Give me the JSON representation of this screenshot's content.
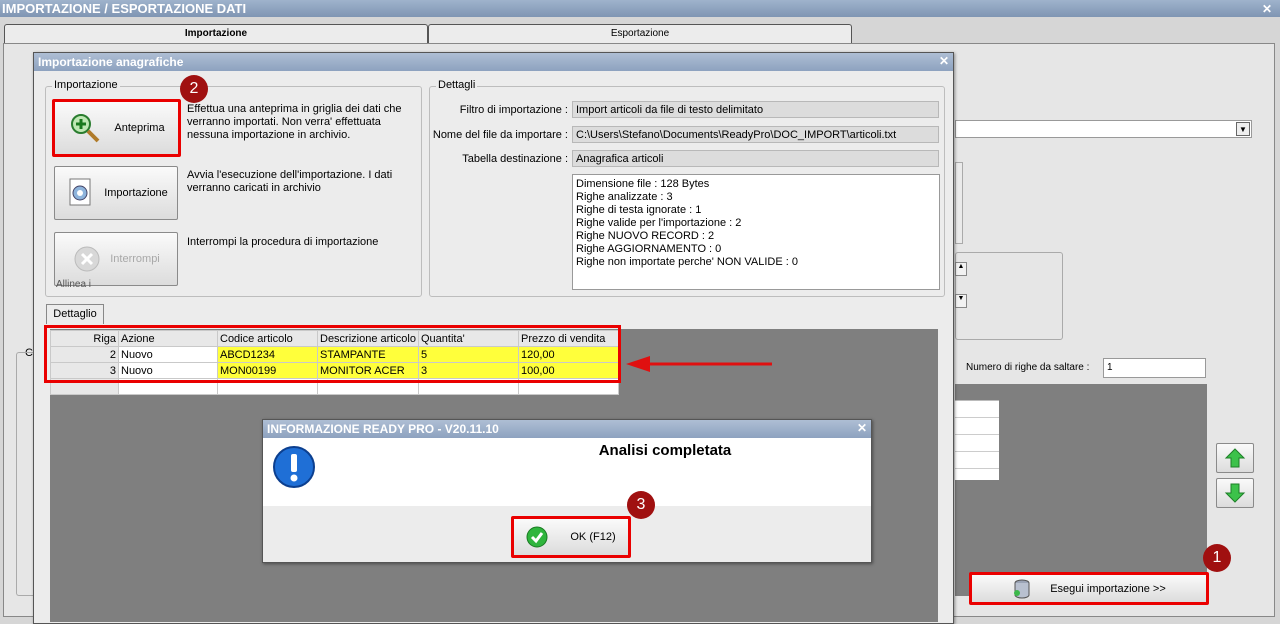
{
  "window": {
    "title": "IMPORTAZIONE / ESPORTAZIONE DATI"
  },
  "tabs": [
    {
      "label": "Importazione"
    },
    {
      "label": "Esportazione"
    }
  ],
  "background": {
    "righe_label": "Numero di righe da saltare :",
    "righe_value": "1",
    "esegui_label": "Esegui importazione >>",
    "left_label_c": "C",
    "hidden_label": "Allinea i"
  },
  "dialog": {
    "title": "Importazione anagrafiche",
    "import_group": "Importazione",
    "anteprima_label": "Anteprima",
    "anteprima_desc": "Effettua una anteprima in griglia dei dati che verranno importati. Non verra' effettuata nessuna importazione in archivio.",
    "importazione_label": "Importazione",
    "importazione_desc": "Avvia l'esecuzione dell'importazione. I dati verranno caricati in archivio",
    "interrompi_label": "Interrompi",
    "interrompi_desc": "Interrompi la procedura di importazione",
    "details_group": "Dettagli",
    "filtro_label": "Filtro di importazione :",
    "filtro_value": "Import articoli da file di testo delimitato",
    "nome_label": "Nome del file da importare :",
    "nome_value": "C:\\Users\\Stefano\\Documents\\ReadyPro\\DOC_IMPORT\\articoli.txt",
    "tabella_label": "Tabella destinazione :",
    "tabella_value": "Anagrafica articoli",
    "stats": [
      "Dimensione file : 128 Bytes",
      "Righe analizzate : 3",
      "Righe di testa ignorate : 1",
      "Righe valide per l'importazione : 2",
      "Righe NUOVO RECORD : 2",
      "Righe AGGIORNAMENTO  : 0",
      "Righe non importate perche' NON VALIDE : 0"
    ],
    "dettaglio_tab": "Dettaglio"
  },
  "grid": {
    "headers": [
      "Riga",
      "Azione",
      "Codice articolo",
      "Descrizione articolo",
      "Quantita'",
      "Prezzo di vendita"
    ],
    "rows": [
      [
        "2",
        "Nuovo",
        "ABCD1234",
        "STAMPANTE",
        "5",
        "120,00"
      ],
      [
        "3",
        "Nuovo",
        "MON00199",
        "MONITOR ACER",
        "3",
        "100,00"
      ]
    ]
  },
  "msgbox": {
    "title": "INFORMAZIONE READY PRO - V20.11.10",
    "message": "Analisi completata",
    "ok_label": "OK (F12)"
  },
  "badges": [
    "1",
    "2",
    "3"
  ],
  "colors": {
    "highlight_red": "#ea0000",
    "row_yellow": "#ffff3b",
    "badge": "#a01010"
  }
}
